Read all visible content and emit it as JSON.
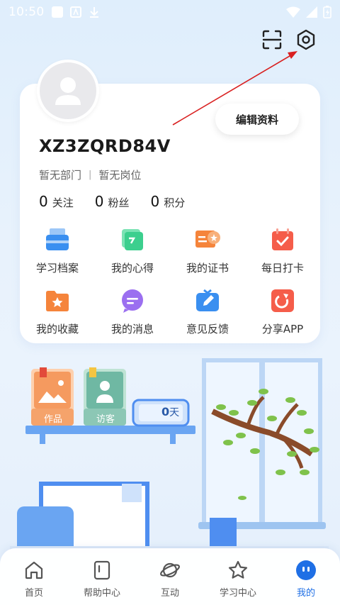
{
  "status_bar": {
    "time": "10:50"
  },
  "header": {
    "scan_icon": "scan-icon",
    "settings_icon": "hexagon-settings-icon"
  },
  "profile": {
    "username": "XZ3ZQRD84V",
    "department": "暂无部门",
    "separator": "|",
    "position": "暂无岗位",
    "edit_label": "编辑资料",
    "stats": [
      {
        "value": "0",
        "label": "关注"
      },
      {
        "value": "0",
        "label": "粉丝"
      },
      {
        "value": "0",
        "label": "积分"
      }
    ]
  },
  "features": [
    {
      "label": "学习档案",
      "icon": "study-file-icon",
      "color": "#3a8ff0"
    },
    {
      "label": "我的心得",
      "icon": "notes-icon",
      "color": "#3ccf8e"
    },
    {
      "label": "我的证书",
      "icon": "certificate-icon",
      "color": "#f5843b"
    },
    {
      "label": "每日打卡",
      "icon": "calendar-check-icon",
      "color": "#f55d4a"
    },
    {
      "label": "我的收藏",
      "icon": "star-folder-icon",
      "color": "#f5843b"
    },
    {
      "label": "我的消息",
      "icon": "chat-icon",
      "color": "#9b6ff0"
    },
    {
      "label": "意见反馈",
      "icon": "feedback-icon",
      "color": "#3a8ff0"
    },
    {
      "label": "分享APP",
      "icon": "share-icon",
      "color": "#f55d4a"
    }
  ],
  "illustration": {
    "works_label": "作品",
    "visitor_label": "访客",
    "days_value": "0",
    "days_unit": "天"
  },
  "nav": {
    "items": [
      {
        "label": "首页",
        "icon": "home-icon"
      },
      {
        "label": "帮助中心",
        "icon": "book-icon"
      },
      {
        "label": "互动",
        "icon": "planet-icon"
      },
      {
        "label": "学习中心",
        "icon": "star-icon"
      },
      {
        "label": "我的",
        "icon": "profile-face-icon"
      }
    ],
    "active_index": 4,
    "active_color": "#1f6fe5"
  }
}
